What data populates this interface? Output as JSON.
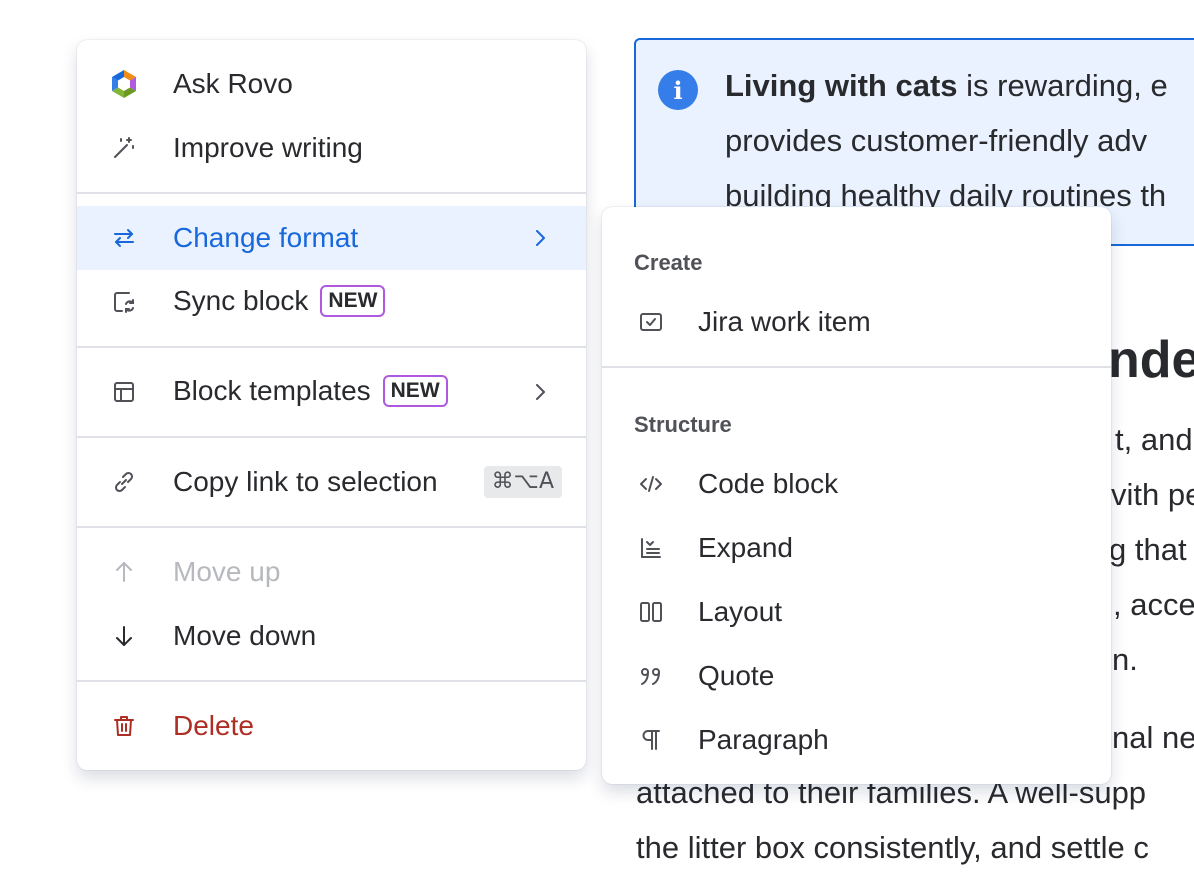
{
  "document": {
    "panel": {
      "bold_text": "Living with cats",
      "line1_rest": " is rewarding, e",
      "line2": "provides customer-friendly adv",
      "line3": "building healthy daily routines th"
    },
    "heading_fragment": "nde",
    "body_fragments": [
      "t, and",
      "vith pe",
      "g that t",
      ", acce",
      "n.",
      "nal ne"
    ],
    "line_attached": "attached to their families. A well-supp",
    "line_litter": "the litter box consistently, and settle c"
  },
  "main_menu": {
    "items": [
      {
        "label": "Ask Rovo",
        "icon": "rovo-logo-icon"
      },
      {
        "label": "Improve writing",
        "icon": "magic-wand-icon"
      },
      {
        "label": "Change format",
        "icon": "swap-arrows-icon"
      },
      {
        "label": "Sync block",
        "icon": "sync-block-icon",
        "badge": "NEW"
      },
      {
        "label": "Block templates",
        "icon": "template-icon",
        "badge": "NEW"
      },
      {
        "label": "Copy link to selection",
        "icon": "link-icon",
        "shortcut": "⌘⌥A"
      },
      {
        "label": "Move up",
        "icon": "arrow-up-icon"
      },
      {
        "label": "Move down",
        "icon": "arrow-down-icon"
      },
      {
        "label": "Delete",
        "icon": "trash-icon"
      }
    ]
  },
  "sub_menu": {
    "create_heading": "Create",
    "create_items": [
      {
        "label": "Jira work item",
        "icon": "jira-work-item-icon"
      }
    ],
    "structure_heading": "Structure",
    "structure_items": [
      {
        "label": "Code block",
        "icon": "code-icon"
      },
      {
        "label": "Expand",
        "icon": "expand-icon"
      },
      {
        "label": "Layout",
        "icon": "layout-columns-icon"
      },
      {
        "label": "Quote",
        "icon": "quote-icon"
      },
      {
        "label": "Paragraph",
        "icon": "paragraph-icon"
      }
    ]
  },
  "colors": {
    "accent": "#1868db",
    "selected_bg": "#e9f2fe",
    "danger": "#ae2e24",
    "badge_border": "#af59e1",
    "disabled_text": "#b7b9be"
  }
}
